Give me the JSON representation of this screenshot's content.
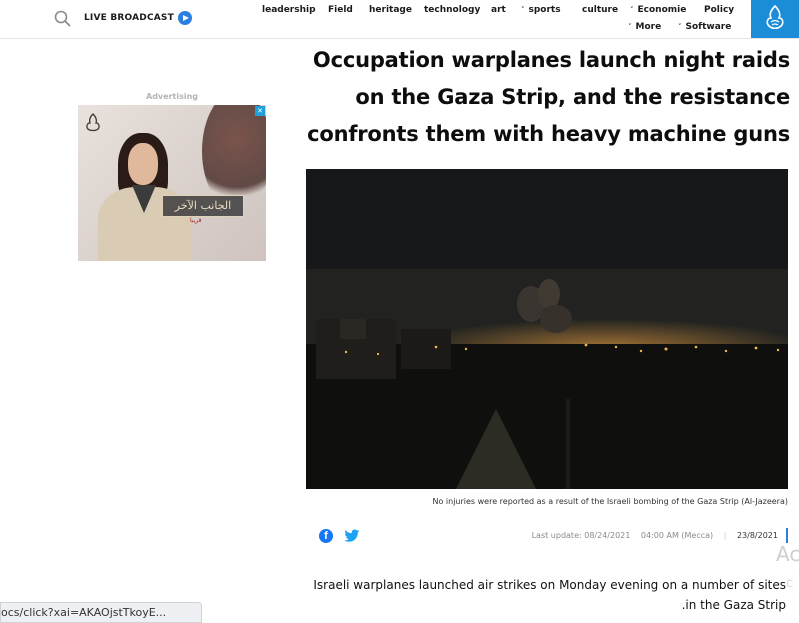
{
  "header": {
    "live_broadcast": "LIVE BROADCAST",
    "nav": [
      {
        "label": "leadership",
        "chevron": false
      },
      {
        "label": "Field",
        "chevron": false
      },
      {
        "label": "heritage",
        "chevron": false
      },
      {
        "label": "technology",
        "chevron": false
      },
      {
        "label": "art",
        "chevron": false
      },
      {
        "label": "sports",
        "chevron": true
      },
      {
        "label": "culture",
        "chevron": false
      },
      {
        "label": "Economie",
        "chevron": true
      },
      {
        "label": "Policy",
        "chevron": false
      },
      {
        "label": "More",
        "chevron": true
      },
      {
        "label": "Software",
        "chevron": true
      }
    ],
    "chevron_glyph": "˅",
    "accent_color": "#1a8cd8"
  },
  "ad": {
    "label": "Advertising",
    "title_text": "الجانب الآخر",
    "sub_text": "قريبا"
  },
  "article": {
    "headline": "Occupation warplanes launch night raids on the Gaza Strip, and the resistance confronts them with heavy machine guns",
    "caption": "No injuries were reported as a result of the Israeli bombing of the Gaza Strip (Al-Jazeera)",
    "last_update": "Last update: 08/24/2021",
    "time": "04:00 AM (Mecca)",
    "date": "23/8/2021",
    "body": "Israeli warplanes launched air strikes on Monday evening on a number of sites .in the Gaza Strip"
  },
  "ghost": {
    "ac": "Ac",
    "c": "c"
  },
  "status_bar": {
    "url": "ocs/click?xai=AKAOjstTkoyE..."
  },
  "icons": [
    "search-icon",
    "play-icon",
    "aljazeera-logo-icon",
    "facebook-icon",
    "twitter-icon",
    "ad-close-icon"
  ]
}
